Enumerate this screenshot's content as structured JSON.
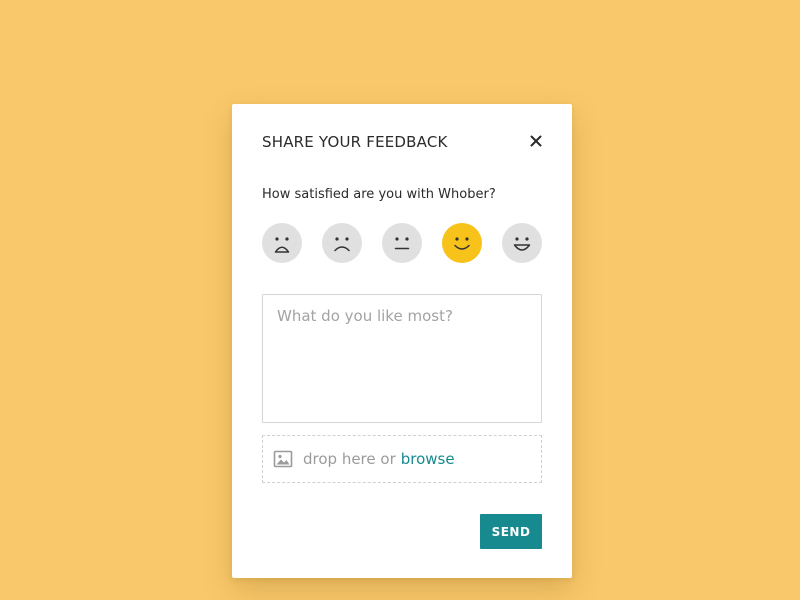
{
  "dialog": {
    "title": "SHARE YOUR FEEDBACK",
    "close_icon": "close-icon",
    "question": "How satisfied are you with Whober?",
    "rating": {
      "options": [
        "very-unsatisfied",
        "unsatisfied",
        "neutral",
        "satisfied",
        "very-satisfied"
      ],
      "selected_index": 3,
      "selected_color": "#f7c21a",
      "unselected_color": "#e0e0e0"
    },
    "comment": {
      "placeholder": "What do you like most?",
      "value": ""
    },
    "upload": {
      "icon": "image-icon",
      "text": "drop here or",
      "link_label": "browse"
    },
    "send_label": "SEND"
  },
  "colors": {
    "background": "#f9c86a",
    "accent": "#168a8e",
    "link": "#178a8f"
  }
}
